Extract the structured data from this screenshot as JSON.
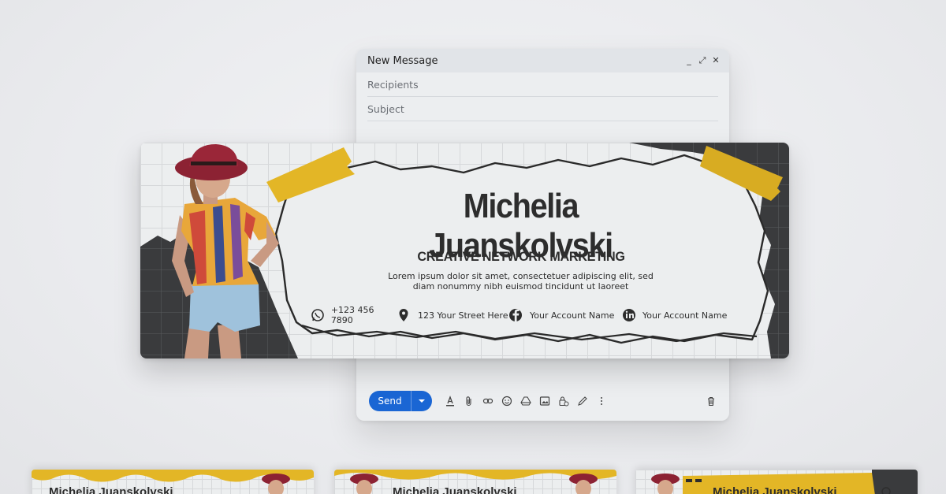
{
  "compose": {
    "title": "New Message",
    "controls": [
      "_",
      "⤢",
      "✕"
    ],
    "recipients_placeholder": "Recipients",
    "subject_placeholder": "Subject",
    "send_label": "Send",
    "toolbar_icons": [
      "format-text-icon",
      "attach-icon",
      "link-icon",
      "emoji-icon",
      "drive-icon",
      "image-icon",
      "lock-clock-icon",
      "pen-icon",
      "more-icon",
      "trash-icon"
    ]
  },
  "signature": {
    "name": "Michelia Juanskolvski",
    "role": "CREATIVE NETWORK MARKETING",
    "description_line1": "Lorem ipsum dolor sit amet, consectetuer adipiscing elit, sed",
    "description_line2": "diam nonummy nibh euismod tincidunt ut laoreet",
    "phone": "+123 456 7890",
    "address": "123 Your Street Here",
    "facebook": "Your Account Name",
    "linkedin": "Your Account Name"
  },
  "previews": [
    {
      "name": "Michelia Juanskolvski"
    },
    {
      "name": "Michelia Juanskolvski"
    },
    {
      "name": "Michelia Juanskolvski"
    }
  ],
  "colors": {
    "accent_yellow": "#e3b626",
    "dark": "#3a3b3d",
    "send_blue": "#1a66d4",
    "hat": "#8c2233"
  }
}
